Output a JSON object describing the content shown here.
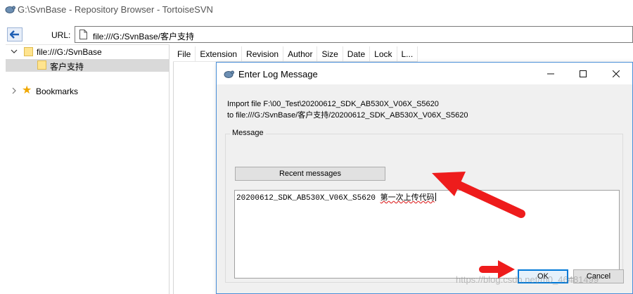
{
  "window": {
    "title": "G:\\SvnBase - Repository Browser - TortoiseSVN"
  },
  "toolbar": {
    "url_label": "URL:",
    "url_value": "file:///G:/SvnBase/客户支持"
  },
  "tree": {
    "root_label": "file:///G:/SvnBase",
    "child_label": "客户支持",
    "bookmarks_label": "Bookmarks"
  },
  "list": {
    "columns": [
      "File",
      "Extension",
      "Revision",
      "Author",
      "Size",
      "Date",
      "Lock",
      "L..."
    ]
  },
  "dialog": {
    "title": "Enter Log Message",
    "import_line1": "Import file F:\\00_Test\\20200612_SDK_AB530X_V06X_S5620",
    "import_line2": "to file:///G:/SvnBase/客户支持/20200612_SDK_AB530X_V06X_S5620",
    "group_label": "Message",
    "recent_button": "Recent messages",
    "message_text_ascii": "20200612_SDK_AB530X_V06X_S5620 ",
    "message_text_cn": "第一次上传代码",
    "ok_button": "OK",
    "cancel_button": "Cancel"
  },
  "watermark": "https://blog.csdn.net/m0_46481499",
  "colors": {
    "accent": "#0078d7",
    "arrow": "#ee1c1c",
    "folder": "#ffe48f"
  },
  "icons": {
    "app": "tortoise-icon",
    "back": "back-arrow-icon",
    "file": "file-icon",
    "folder": "folder-icon",
    "bookmark": "star-icon"
  }
}
